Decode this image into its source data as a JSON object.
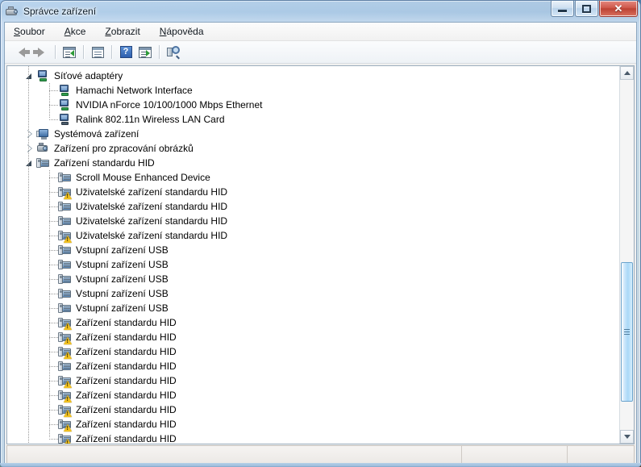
{
  "window": {
    "title": "Správce zařízení",
    "title_icon": "device-manager-icon",
    "minimize_label": "",
    "maximize_label": "",
    "close_label": "✕"
  },
  "menu": {
    "items": [
      {
        "accel": "S",
        "rest": "oubor",
        "name": "menu-soubor"
      },
      {
        "accel": "A",
        "rest": "kce",
        "name": "menu-akce"
      },
      {
        "accel": "Z",
        "rest": "obrazit",
        "name": "menu-zobrazit"
      },
      {
        "accel": "N",
        "rest": "ápověda",
        "name": "menu-napoveda"
      }
    ]
  },
  "toolbar": {
    "buttons": [
      {
        "name": "back-button",
        "icon": "arrow-left-icon"
      },
      {
        "name": "forward-button",
        "icon": "arrow-right-icon"
      },
      {
        "name": "show-hidden-button",
        "icon": "window-back-icon"
      },
      {
        "name": "properties-button",
        "icon": "properties-icon"
      },
      {
        "name": "help-button",
        "icon": "help-icon",
        "glyph": "?"
      },
      {
        "name": "update-driver-button",
        "icon": "window-forward-icon"
      },
      {
        "name": "scan-hardware-button",
        "icon": "scan-hardware-icon"
      }
    ]
  },
  "tree": {
    "nodes": [
      {
        "label": "Síťové adaptéry",
        "level": 0,
        "state": "expanded",
        "icon": "network-adapter-icon",
        "warning": false
      },
      {
        "label": "Hamachi Network Interface",
        "level": 1,
        "state": "leaf",
        "icon": "network-adapter-icon",
        "warning": false
      },
      {
        "label": "NVIDIA nForce 10/100/1000 Mbps Ethernet",
        "level": 1,
        "state": "leaf",
        "icon": "network-adapter-icon",
        "warning": false
      },
      {
        "label": "Ralink 802.11n Wireless LAN Card",
        "level": 1,
        "state": "leaf",
        "icon": "network-adapter-disabled-icon",
        "warning": false
      },
      {
        "label": "Systémová zařízení",
        "level": 0,
        "state": "collapsed",
        "icon": "system-device-icon",
        "warning": false
      },
      {
        "label": "Zařízení pro zpracování obrázků",
        "level": 0,
        "state": "collapsed",
        "icon": "imaging-device-icon",
        "warning": false
      },
      {
        "label": "Zařízení standardu HID",
        "level": 0,
        "state": "expanded",
        "icon": "hid-device-icon",
        "warning": false
      },
      {
        "label": "Scroll Mouse Enhanced Device",
        "level": 1,
        "state": "leaf",
        "icon": "hid-device-icon",
        "warning": false
      },
      {
        "label": "Uživatelské zařízení standardu HID",
        "level": 1,
        "state": "leaf",
        "icon": "hid-device-icon",
        "warning": true
      },
      {
        "label": "Uživatelské zařízení standardu HID",
        "level": 1,
        "state": "leaf",
        "icon": "hid-device-icon",
        "warning": false
      },
      {
        "label": "Uživatelské zařízení standardu HID",
        "level": 1,
        "state": "leaf",
        "icon": "hid-device-icon",
        "warning": false
      },
      {
        "label": "Uživatelské zařízení standardu HID",
        "level": 1,
        "state": "leaf",
        "icon": "hid-device-icon",
        "warning": true
      },
      {
        "label": "Vstupní zařízení USB",
        "level": 1,
        "state": "leaf",
        "icon": "hid-device-icon",
        "warning": false
      },
      {
        "label": "Vstupní zařízení USB",
        "level": 1,
        "state": "leaf",
        "icon": "hid-device-icon",
        "warning": false
      },
      {
        "label": "Vstupní zařízení USB",
        "level": 1,
        "state": "leaf",
        "icon": "hid-device-icon",
        "warning": false
      },
      {
        "label": "Vstupní zařízení USB",
        "level": 1,
        "state": "leaf",
        "icon": "hid-device-icon",
        "warning": false
      },
      {
        "label": "Vstupní zařízení USB",
        "level": 1,
        "state": "leaf",
        "icon": "hid-device-icon",
        "warning": false
      },
      {
        "label": "Zařízení standardu HID",
        "level": 1,
        "state": "leaf",
        "icon": "hid-device-icon",
        "warning": true
      },
      {
        "label": "Zařízení standardu HID",
        "level": 1,
        "state": "leaf",
        "icon": "hid-device-icon",
        "warning": true
      },
      {
        "label": "Zařízení standardu HID",
        "level": 1,
        "state": "leaf",
        "icon": "hid-device-icon",
        "warning": true
      },
      {
        "label": "Zařízení standardu HID",
        "level": 1,
        "state": "leaf",
        "icon": "hid-device-icon",
        "warning": false
      },
      {
        "label": "Zařízení standardu HID",
        "level": 1,
        "state": "leaf",
        "icon": "hid-device-icon",
        "warning": true
      },
      {
        "label": "Zařízení standardu HID",
        "level": 1,
        "state": "leaf",
        "icon": "hid-device-icon",
        "warning": true
      },
      {
        "label": "Zařízení standardu HID",
        "level": 1,
        "state": "leaf",
        "icon": "hid-device-icon",
        "warning": true
      },
      {
        "label": "Zařízení standardu HID",
        "level": 1,
        "state": "leaf",
        "icon": "hid-device-icon",
        "warning": true
      },
      {
        "label": "Zařízení standardu HID",
        "level": 1,
        "state": "leaf",
        "icon": "hid-device-icon",
        "warning": true
      }
    ]
  },
  "scrollbar": {
    "vertical": {
      "thumb_top_pct": 52,
      "thumb_height_pct": 40
    }
  },
  "statusbar": {
    "main_text": "",
    "pane1_text": "",
    "pane2_text": ""
  }
}
